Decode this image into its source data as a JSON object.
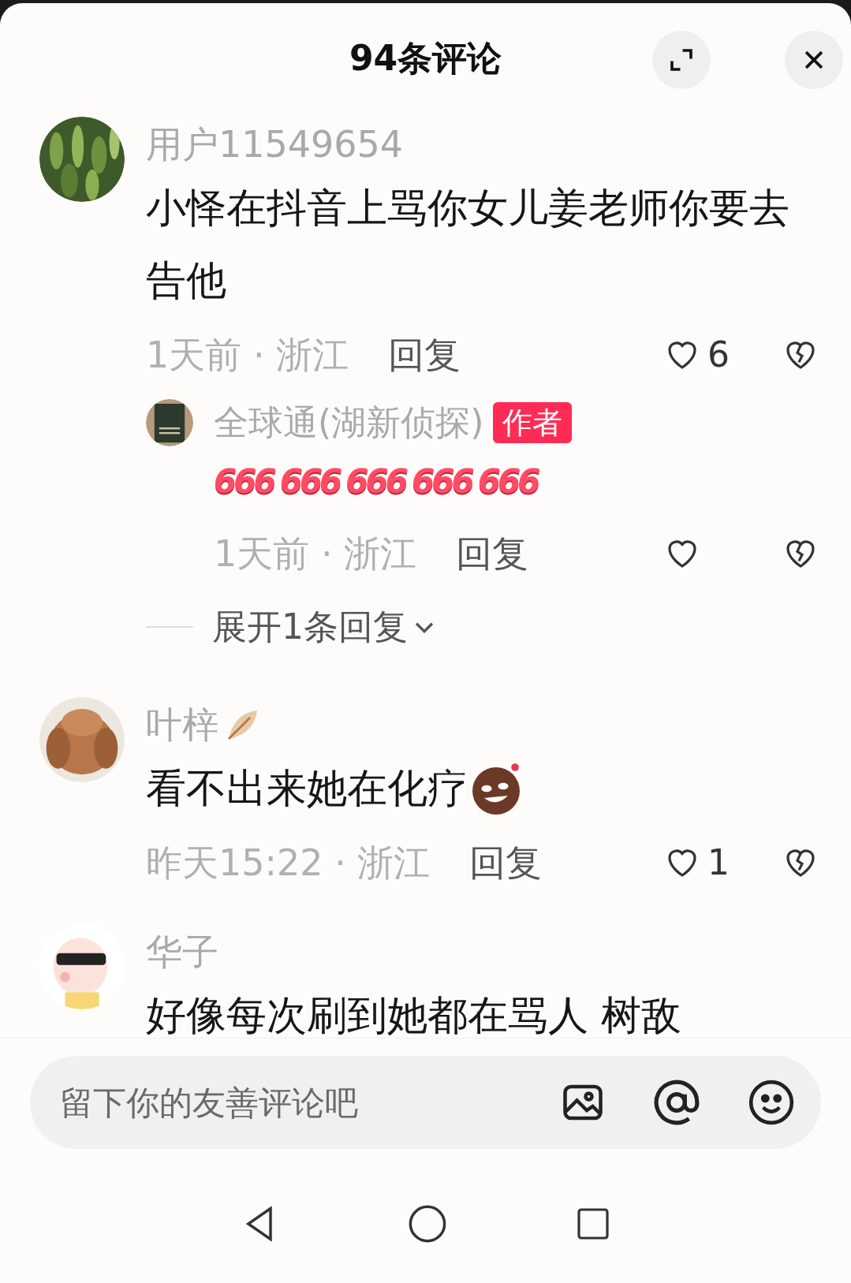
{
  "header": {
    "title": "94条评论"
  },
  "comments": [
    {
      "author": "用户11549654",
      "name_sticker": false,
      "text": "小怿在抖音上骂你女儿姜老师你要去告他",
      "text_sticker": false,
      "meta": "1天前 · 浙江",
      "reply_label": "回复",
      "likes": "6",
      "replies": [
        {
          "author": "全球通(湖新侦探)",
          "badge": "作者",
          "stickers": [
            "666",
            "666",
            "666",
            "666",
            "666"
          ],
          "meta": "1天前 · 浙江",
          "reply_label": "回复"
        }
      ],
      "expand_label": "展开1条回复"
    },
    {
      "author": "叶梓",
      "name_sticker": true,
      "text": "看不出来她在化疗",
      "text_sticker": true,
      "meta": "昨天15:22 · 浙江",
      "reply_label": "回复",
      "likes": "1"
    },
    {
      "author": "华子",
      "name_sticker": false,
      "text": "好像每次刷到她都在骂人 树敌",
      "text_sticker": false
    }
  ],
  "input": {
    "placeholder": "留下你的友善评论吧"
  }
}
